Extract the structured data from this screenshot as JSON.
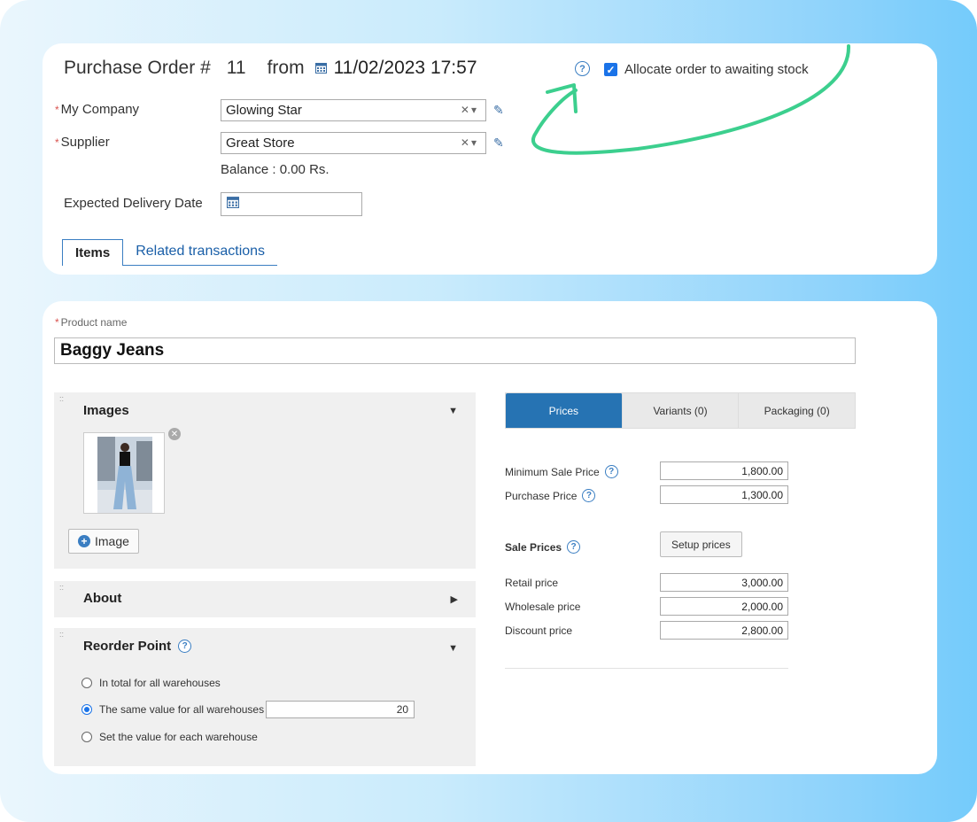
{
  "order": {
    "title": "Purchase Order #",
    "number": "11",
    "from_label": "from",
    "datetime": "11/02/2023 17:57",
    "allocate_label": "Allocate order to awaiting stock",
    "my_company_label": "My Company",
    "my_company_value": "Glowing Star",
    "supplier_label": "Supplier",
    "supplier_value": "Great Store",
    "balance": "Balance : 0.00 Rs.",
    "expected_delivery_label": "Expected Delivery Date",
    "tabs": [
      "Items",
      "Related transactions"
    ]
  },
  "product": {
    "name_label": "Product name",
    "name_value": "Baggy Jeans",
    "images_title": "Images",
    "image_button": "Image",
    "about_title": "About",
    "reorder_title": "Reorder Point",
    "reorder_options": [
      "In total for all warehouses",
      "The same value for all warehouses",
      "Set the value for each warehouse"
    ],
    "reorder_value": "20",
    "tabs": [
      "Prices",
      "Variants (0)",
      "Packaging (0)"
    ],
    "min_sale_label": "Minimum Sale Price",
    "min_sale_value": "1,800.00",
    "purchase_label": "Purchase Price",
    "purchase_value": "1,300.00",
    "sale_prices_label": "Sale Prices",
    "setup_button": "Setup prices",
    "retail_label": "Retail price",
    "retail_value": "3,000.00",
    "wholesale_label": "Wholesale price",
    "wholesale_value": "2,000.00",
    "discount_label": "Discount price",
    "discount_value": "2,800.00"
  },
  "colors": {
    "accent": "#2673b3",
    "annotation": "#3ccf8e",
    "required": "#d9534f"
  }
}
